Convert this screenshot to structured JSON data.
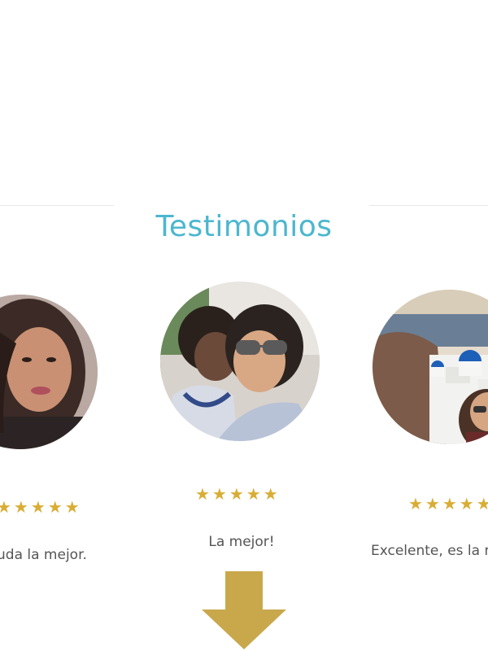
{
  "section": {
    "title": "Testimonios",
    "title_color": "#4bb7cf"
  },
  "colors": {
    "star": "#d9ad35",
    "arrow": "#c9a84c",
    "divider": "#e6e6e6"
  },
  "testimonials": [
    {
      "position": "left",
      "photo_icon": "woman-portrait",
      "rating": 5,
      "stars": "★★★★★",
      "quote": "uda la mejor."
    },
    {
      "position": "center",
      "photo_icon": "mother-and-son-portrait",
      "rating": 5,
      "stars": "★★★★★",
      "quote": "La mejor!"
    },
    {
      "position": "right",
      "photo_icon": "santorini-travel-portrait",
      "rating": 5,
      "stars": "★★★★★",
      "quote": "Excelente, es la m"
    }
  ],
  "scroll_indicator": {
    "icon": "arrow-down-icon"
  }
}
